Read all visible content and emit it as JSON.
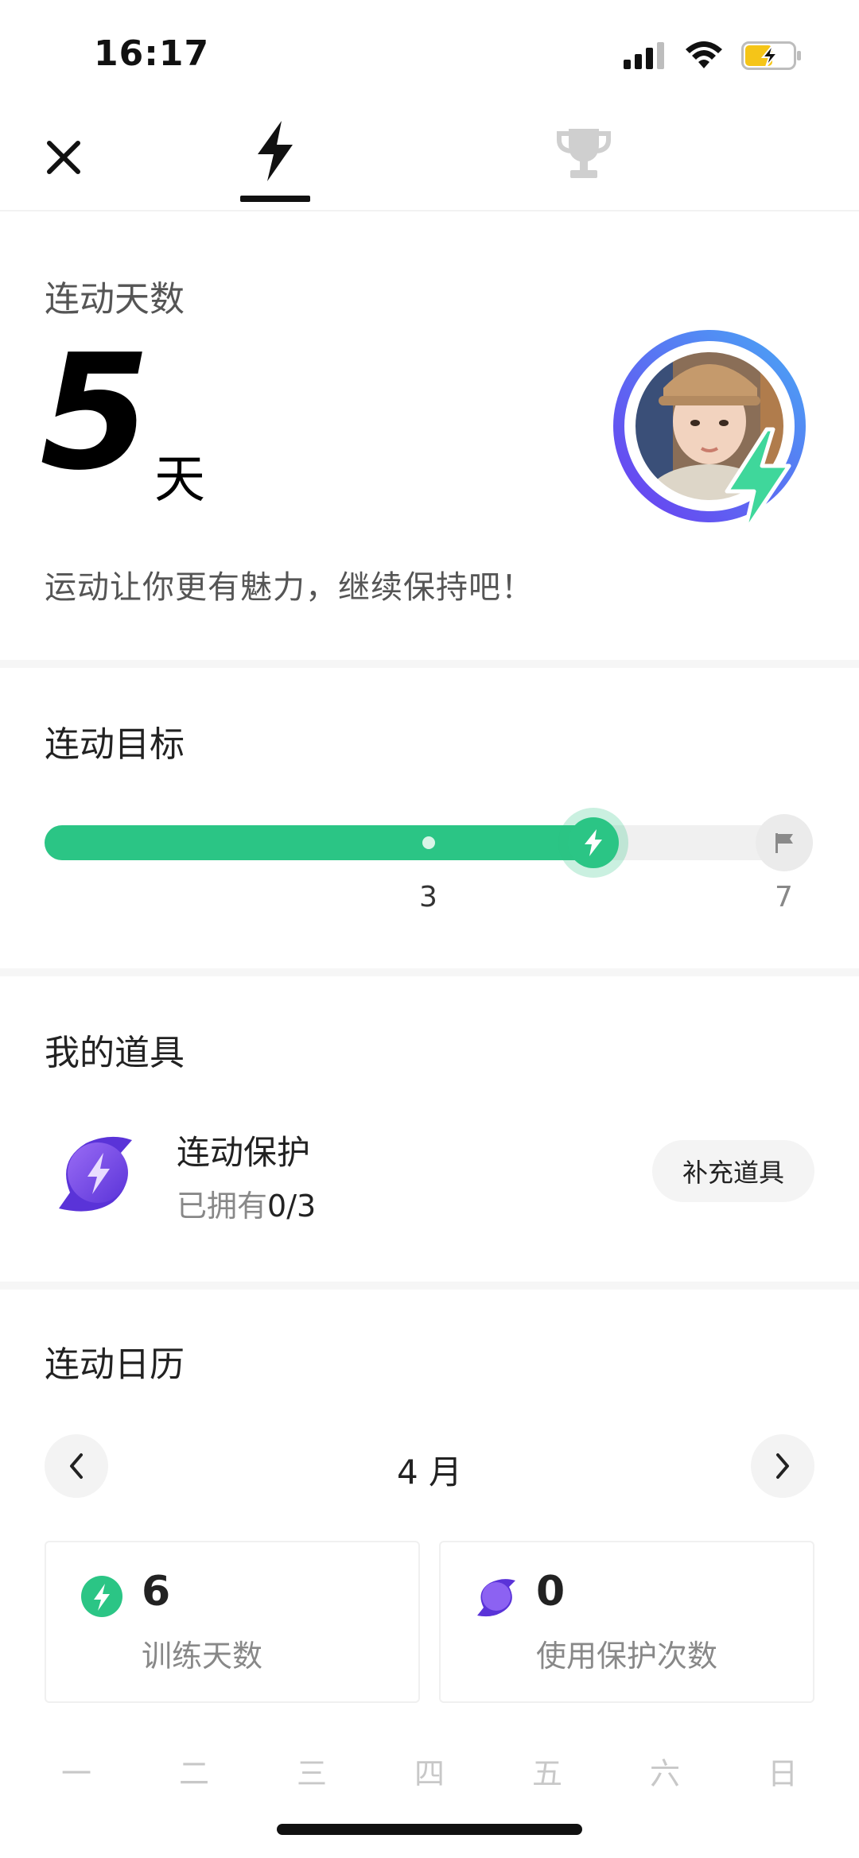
{
  "status": {
    "time": "16:17"
  },
  "header": {
    "close_icon": "close-icon",
    "tab_active_icon": "lightning-icon",
    "tab_inactive_icon": "trophy-icon"
  },
  "streak": {
    "label": "连动天数",
    "days": "5",
    "unit": "天",
    "motto": "运动让你更有魅力，继续保持吧！"
  },
  "goal": {
    "title": "连动目标",
    "current": 5,
    "target": 7,
    "tick_mid": "3",
    "tick_end": "7",
    "colors": {
      "fill": "#2bc585",
      "track": "#f0f0f0"
    }
  },
  "items": {
    "title": "我的道具",
    "name": "连动保护",
    "owned_label": "已拥有",
    "owned_value": "0/3",
    "button_label": "补充道具"
  },
  "calendar": {
    "title": "连动日历",
    "month": "4 月",
    "stats": [
      {
        "value": "6",
        "label": "训练天数",
        "icon": "green-lightning-icon"
      },
      {
        "value": "0",
        "label": "使用保护次数",
        "icon": "purple-shield-icon"
      }
    ],
    "weekdays": [
      "一",
      "二",
      "三",
      "四",
      "五",
      "六",
      "日"
    ]
  }
}
